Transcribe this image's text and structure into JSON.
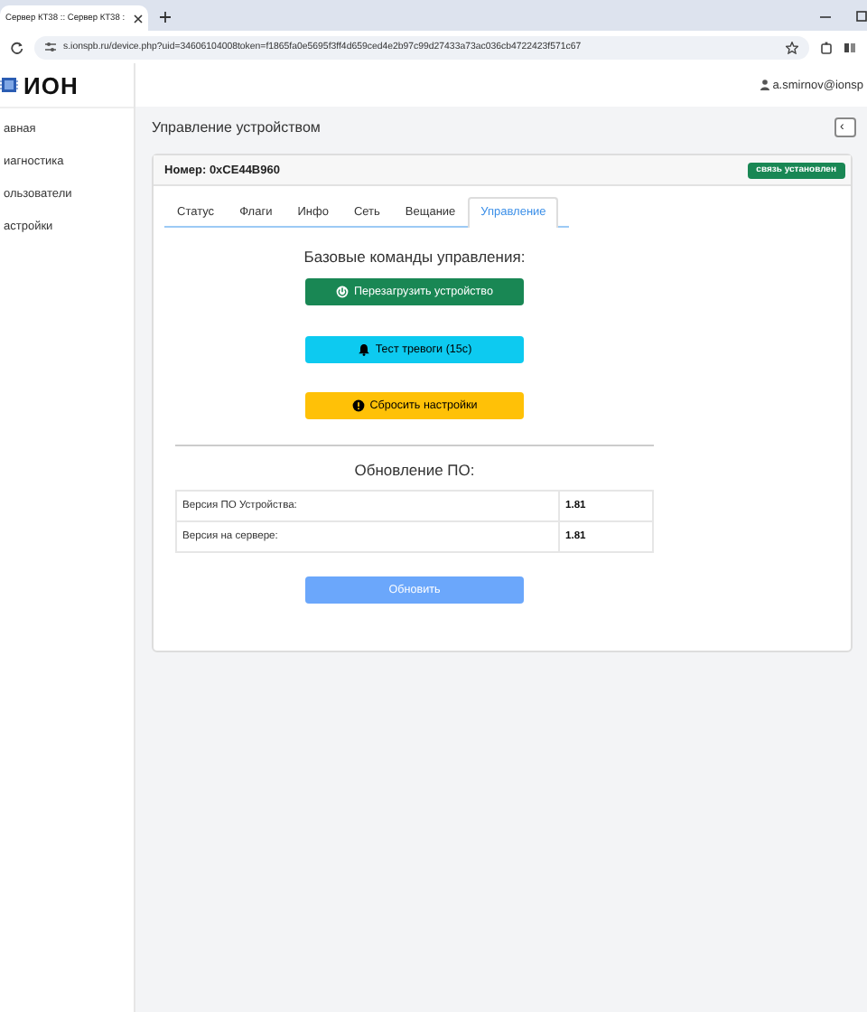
{
  "browser": {
    "tab_title": "Сервер КТ38 :: Сервер КТ38 :",
    "url": "s.ionspb.ru/device.php?uid=34606104008token=f1865fa0e5695f3ff4d659ced4e2b97c99d27433a73ac036cb4722423f571c67"
  },
  "header": {
    "logo": "ИОН",
    "user": "a.smirnov@ionsp"
  },
  "sidebar": {
    "items": [
      {
        "label": "авная"
      },
      {
        "label": "иагностика"
      },
      {
        "label": "ользователи"
      },
      {
        "label": "астройки"
      }
    ]
  },
  "page_title": "Управление устройством",
  "back_button": "‹",
  "card": {
    "number": "Номер: 0xCE44B960",
    "status": "связь установлен",
    "tabs": [
      {
        "label": "Статус",
        "selected": false
      },
      {
        "label": "Флаги",
        "selected": false
      },
      {
        "label": "Инфо",
        "selected": false
      },
      {
        "label": "Сеть",
        "selected": false
      },
      {
        "label": "Вещание",
        "selected": false
      },
      {
        "label": "Управление",
        "selected": true
      }
    ],
    "commands_title": "Базовые команды управления:",
    "commands": [
      {
        "kind": "restart",
        "label": "Перезагрузить устройство"
      },
      {
        "kind": "alarm",
        "label": "Тест тревоги (15с)"
      },
      {
        "kind": "reset",
        "label": "Сбросить настройки"
      }
    ],
    "firmware_title": "Обновление ПО:",
    "firmware_rows": [
      {
        "name": "Версия ПО Устройства:",
        "value": "1.81"
      },
      {
        "name": "Версия на сервере:",
        "value": "1.81"
      }
    ],
    "update_button": "Обновить"
  }
}
